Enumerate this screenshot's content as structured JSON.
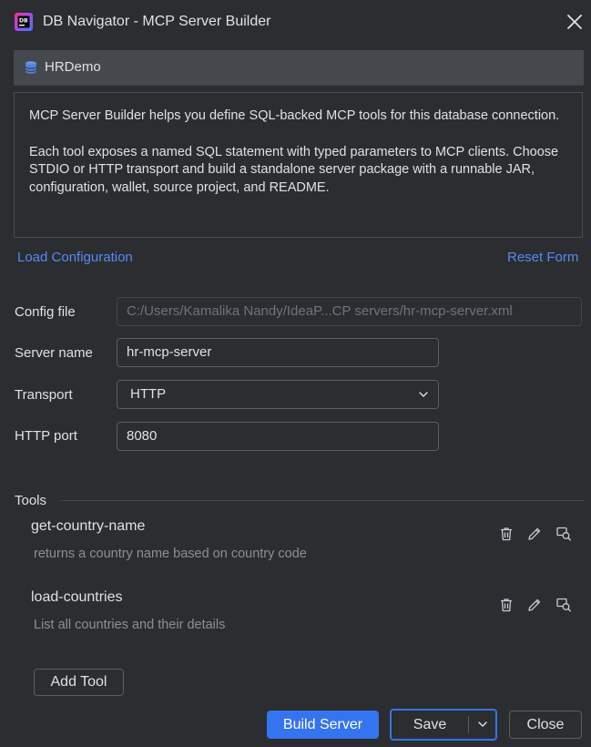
{
  "window": {
    "title": "DB Navigator - MCP Server Builder",
    "close_icon": "close-icon"
  },
  "connection": {
    "name": "HRDemo",
    "icon": "database-icon"
  },
  "info": {
    "paragraph1": "MCP Server Builder helps you define SQL-backed MCP tools for this database connection.",
    "paragraph2": "Each tool exposes a named SQL statement with typed parameters to MCP clients. Choose STDIO or HTTP transport and build a standalone server package with a runnable JAR, configuration, wallet, source project, and README."
  },
  "links": {
    "load_configuration": "Load Configuration",
    "reset_form": "Reset Form"
  },
  "form": {
    "config_file_label": "Config file",
    "config_file_value": "C:/Users/Kamalika Nandy/IdeaP...CP servers/hr-mcp-server.xml",
    "server_name_label": "Server name",
    "server_name_value": "hr-mcp-server",
    "transport_label": "Transport",
    "transport_value": "HTTP",
    "http_port_label": "HTTP port",
    "http_port_value": "8080"
  },
  "tools": {
    "section_label": "Tools",
    "items": [
      {
        "name": "get-country-name",
        "description": "returns a country name based on country code"
      },
      {
        "name": "load-countries",
        "description": "List all countries and their details"
      }
    ],
    "action_icons": [
      "trash-icon",
      "pencil-icon",
      "inspect-icon"
    ]
  },
  "buttons": {
    "add_tool": "Add Tool",
    "build_server": "Build Server",
    "save": "Save",
    "close": "Close"
  },
  "colors": {
    "background": "#2b2d30",
    "accent": "#3574f0",
    "link": "#548af7",
    "text": "#dfe1e5",
    "muted_text": "#8c8f94"
  }
}
